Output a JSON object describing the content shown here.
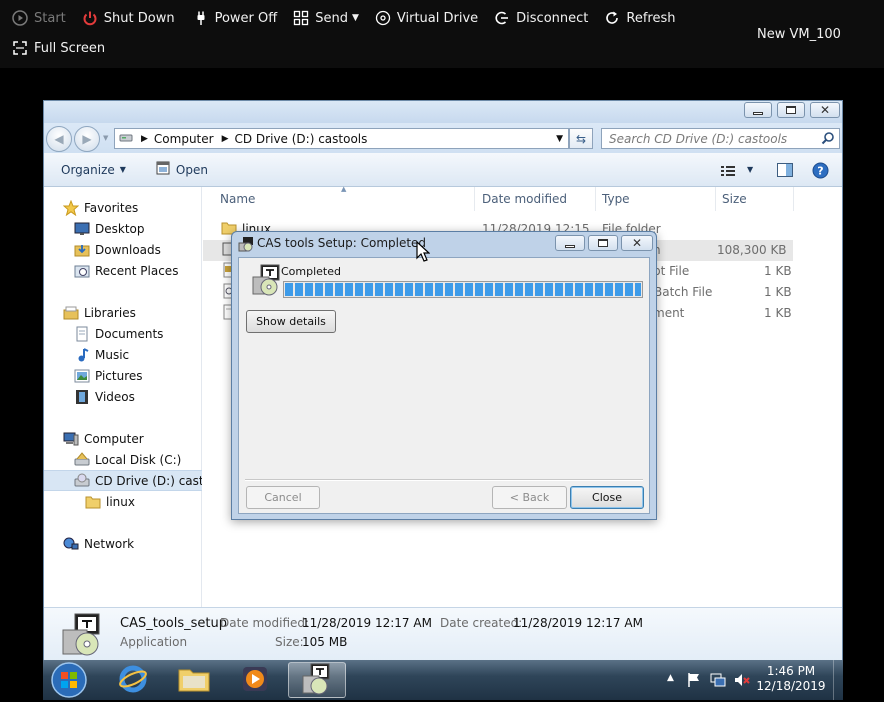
{
  "vm_toolbar": {
    "start": "Start",
    "shut_down": "Shut Down",
    "power_off": "Power Off",
    "send": "Send",
    "virtual_drive": "Virtual Drive",
    "disconnect": "Disconnect",
    "refresh": "Refresh",
    "full_screen": "Full Screen",
    "vm_name": "New VM_100"
  },
  "explorer": {
    "breadcrumb": [
      "Computer",
      "CD Drive (D:) castools"
    ],
    "search_placeholder": "Search CD Drive (D:) castools",
    "organize": "Organize",
    "open": "Open",
    "nav": {
      "favorites": "Favorites",
      "desktop": "Desktop",
      "downloads": "Downloads",
      "recent_places": "Recent Places",
      "libraries": "Libraries",
      "documents": "Documents",
      "music": "Music",
      "pictures": "Pictures",
      "videos": "Videos",
      "computer": "Computer",
      "local_disk": "Local Disk (C:)",
      "cd_drive": "CD Drive (D:) castoo",
      "linux": "linux",
      "network": "Network"
    },
    "columns": {
      "name": "Name",
      "date_modified": "Date modified",
      "type": "Type",
      "size": "Size"
    },
    "files": [
      {
        "name": "linux",
        "date": "11/28/2019 12:15",
        "type": "File folder",
        "size": ""
      },
      {
        "name": "",
        "date": "",
        "type": "n",
        "size": "108,300 KB"
      },
      {
        "name": "",
        "date": "",
        "type": "pt File",
        "size": "1 KB"
      },
      {
        "name": "",
        "date": "",
        "type": "Batch File",
        "size": "1 KB"
      },
      {
        "name": "",
        "date": "",
        "type": "ment",
        "size": "1 KB"
      }
    ],
    "details": {
      "filename": "CAS_tools_setup",
      "kind": "Application",
      "date_modified_label": "Date modified:",
      "date_modified": "11/28/2019 12:17 AM",
      "size_label": "Size:",
      "size": "105 MB",
      "date_created_label": "Date created:",
      "date_created": "11/28/2019 12:17 AM"
    }
  },
  "dialog": {
    "title": "CAS tools Setup: Completed",
    "status": "Completed",
    "progress": 1.0,
    "show_details": "Show details",
    "cancel": "Cancel",
    "back": "< Back",
    "close": "Close"
  },
  "taskbar": {
    "time": "1:46 PM",
    "date": "12/18/2019"
  },
  "colors": {
    "progress_fill": "#3d9be9",
    "vm_bar": "#0d0d0d",
    "power_red": "#e23b3b"
  }
}
